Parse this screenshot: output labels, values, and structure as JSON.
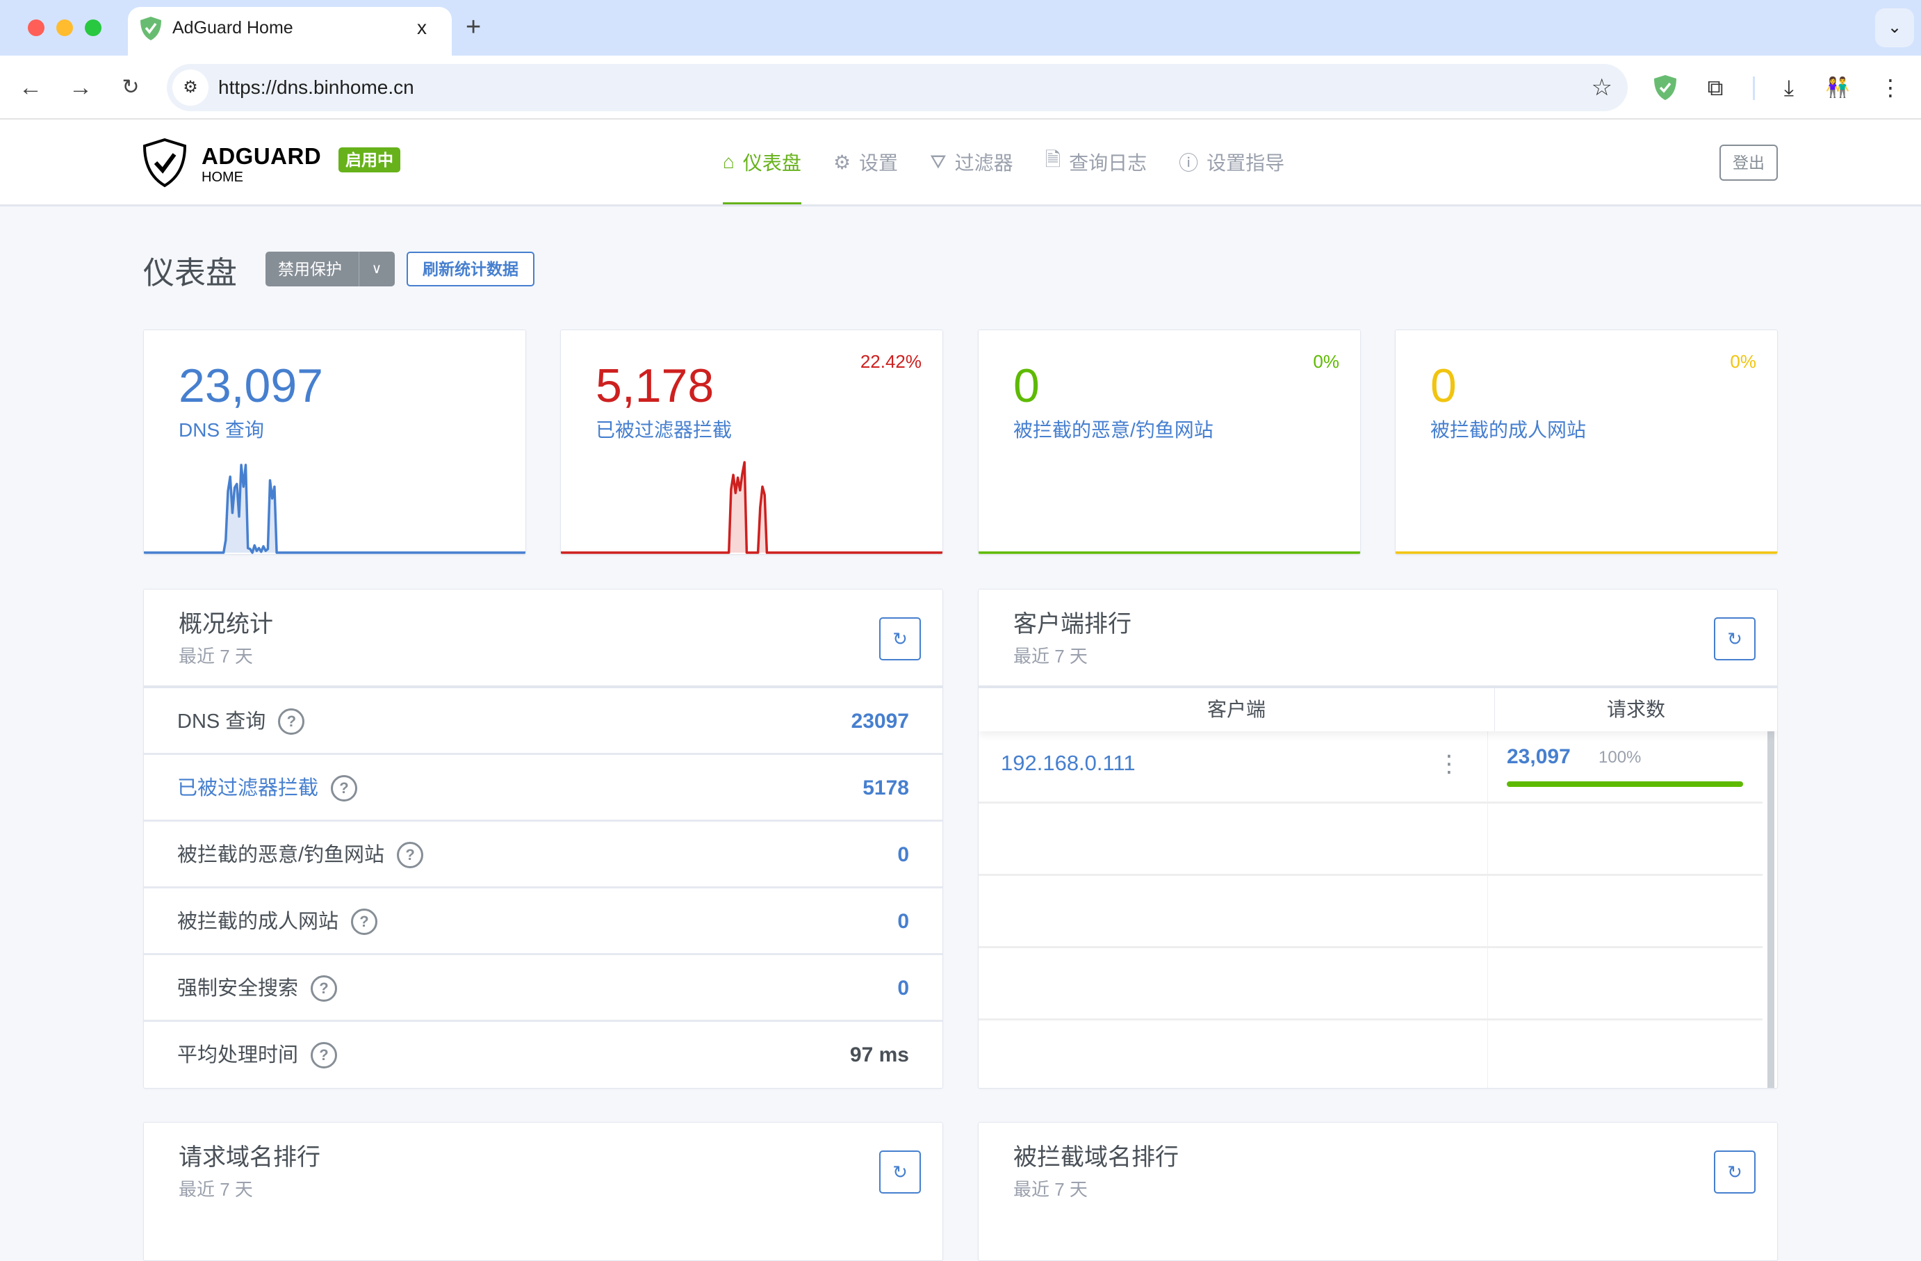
{
  "browser": {
    "tab_title": "AdGuard Home",
    "tab_close": "x",
    "new_tab": "+",
    "url": "https://dns.binhome.cn",
    "icons": [
      "back-icon",
      "forward-icon",
      "reload-icon",
      "site-settings-icon",
      "bookmark-star-icon",
      "adguard-extension-icon",
      "extensions-puzzle-icon",
      "download-icon",
      "profile-avatar",
      "more-menu-icon",
      "tab-list-chevron-icon"
    ]
  },
  "header": {
    "brand": "ADGUARD",
    "brand_sub": "HOME",
    "status_badge": "启用中",
    "nav": [
      {
        "label": "仪表盘",
        "icon": "home-icon",
        "active": true
      },
      {
        "label": "设置",
        "icon": "gear-icon",
        "active": false
      },
      {
        "label": "过滤器",
        "icon": "filter-icon",
        "active": false
      },
      {
        "label": "查询日志",
        "icon": "document-icon",
        "active": false
      },
      {
        "label": "设置指导",
        "icon": "help-circle-icon",
        "active": false
      }
    ],
    "logout": "登出"
  },
  "page": {
    "title": "仪表盘",
    "disable_protection": "禁用保护",
    "refresh_stats": "刷新统计数据"
  },
  "colors": {
    "blue": "#467fcf",
    "red": "#cd201f",
    "green": "#5eba00",
    "yellow": "#f1c40f",
    "badge_green": "#67b21b"
  },
  "stat_cards": [
    {
      "value": "23,097",
      "label": "DNS 查询",
      "percent": "",
      "color": "#467fcf",
      "fill": "#dce6f6",
      "series": [
        0,
        0,
        0,
        0,
        0,
        0,
        0,
        0,
        0,
        0,
        0,
        0,
        0,
        0,
        0,
        0,
        0,
        0,
        0,
        0,
        0,
        0,
        0,
        0,
        0,
        0,
        0,
        0,
        0,
        0,
        0,
        0,
        0,
        0,
        0,
        0,
        0,
        0.14,
        0.68,
        0.84,
        0.44,
        0.72,
        0.76,
        0.4,
        0.97,
        0.73,
        0.97,
        0.05,
        0.04,
        0,
        0.08,
        0.02,
        0.05,
        0.01,
        0.07,
        0.02,
        0.04,
        0.8,
        0.6,
        0.73,
        0,
        0,
        0,
        0,
        0,
        0,
        0,
        0,
        0,
        0,
        0,
        0,
        0,
        0,
        0,
        0,
        0,
        0,
        0,
        0,
        0,
        0,
        0,
        0,
        0,
        0,
        0,
        0,
        0,
        0,
        0,
        0,
        0,
        0,
        0,
        0,
        0,
        0,
        0,
        0,
        0,
        0,
        0,
        0,
        0,
        0,
        0,
        0,
        0,
        0,
        0,
        0,
        0,
        0,
        0,
        0,
        0,
        0,
        0,
        0,
        0,
        0,
        0,
        0,
        0,
        0,
        0,
        0,
        0,
        0,
        0,
        0,
        0,
        0,
        0,
        0,
        0,
        0,
        0,
        0,
        0,
        0,
        0,
        0,
        0,
        0,
        0,
        0,
        0,
        0,
        0,
        0,
        0,
        0,
        0,
        0,
        0,
        0,
        0,
        0,
        0,
        0,
        0,
        0,
        0,
        0,
        0,
        0,
        0,
        0,
        0,
        0,
        0,
        0
      ]
    },
    {
      "value": "5,178",
      "label": "已被过滤器拦截",
      "percent": "22.42%",
      "color": "#cd201f",
      "fill": "#f8d7d7",
      "series": [
        0,
        0,
        0,
        0,
        0,
        0,
        0,
        0,
        0,
        0,
        0,
        0,
        0,
        0,
        0,
        0,
        0,
        0,
        0,
        0,
        0,
        0,
        0,
        0,
        0,
        0,
        0,
        0,
        0,
        0,
        0,
        0,
        0,
        0,
        0,
        0,
        0,
        0,
        0,
        0,
        0,
        0,
        0,
        0,
        0,
        0,
        0,
        0,
        0,
        0,
        0,
        0,
        0,
        0,
        0,
        0,
        0,
        0,
        0,
        0,
        0,
        0,
        0,
        0,
        0,
        0,
        0,
        0,
        0,
        0,
        0,
        0,
        0,
        0,
        0,
        0,
        0.7,
        0.86,
        0.66,
        0.83,
        0.69,
        0.87,
        1.0,
        0,
        0,
        0,
        0,
        0,
        0,
        0.5,
        0.73,
        0.64,
        0,
        0,
        0,
        0,
        0,
        0,
        0,
        0,
        0,
        0,
        0,
        0,
        0,
        0,
        0,
        0,
        0,
        0,
        0,
        0,
        0,
        0,
        0,
        0,
        0,
        0,
        0,
        0,
        0,
        0,
        0,
        0,
        0,
        0,
        0,
        0,
        0,
        0,
        0,
        0,
        0,
        0,
        0,
        0,
        0,
        0,
        0,
        0,
        0,
        0,
        0,
        0,
        0,
        0,
        0,
        0,
        0,
        0,
        0,
        0,
        0,
        0,
        0,
        0,
        0,
        0,
        0,
        0,
        0,
        0,
        0,
        0,
        0,
        0,
        0,
        0,
        0,
        0,
        0,
        0
      ]
    },
    {
      "value": "0",
      "label": "被拦截的恶意/钓鱼网站",
      "percent": "0%",
      "color": "#5eba00",
      "fill": "#e6f4d7",
      "series": []
    },
    {
      "value": "0",
      "label": "被拦截的成人网站",
      "percent": "0%",
      "color": "#f1c40f",
      "fill": "#fcf2cc",
      "series": []
    }
  ],
  "stats_panel": {
    "title": "概况统计",
    "subtitle": "最近 7 天",
    "rows": [
      {
        "label": "DNS 查询",
        "value": "23097",
        "label_link": false,
        "value_color": "blue"
      },
      {
        "label": "已被过滤器拦截",
        "value": "5178",
        "label_link": true,
        "value_color": "blue"
      },
      {
        "label": "被拦截的恶意/钓鱼网站",
        "value": "0",
        "label_link": false,
        "value_color": "blue"
      },
      {
        "label": "被拦截的成人网站",
        "value": "0",
        "label_link": false,
        "value_color": "blue"
      },
      {
        "label": "强制安全搜索",
        "value": "0",
        "label_link": false,
        "value_color": "blue"
      },
      {
        "label": "平均处理时间",
        "value": "97 ms",
        "label_link": false,
        "value_color": "dark"
      }
    ],
    "help_glyph": "?"
  },
  "clients_panel": {
    "title": "客户端排行",
    "subtitle": "最近 7 天",
    "col_client": "客户端",
    "col_requests": "请求数",
    "rows": [
      {
        "client": "192.168.0.111",
        "count": "23,097",
        "percent": "100%",
        "fraction": 1.0
      }
    ]
  },
  "queried_domains_panel": {
    "title": "请求域名排行",
    "subtitle": "最近 7 天"
  },
  "blocked_domains_panel": {
    "title": "被拦截域名排行",
    "subtitle": "最近 7 天"
  }
}
